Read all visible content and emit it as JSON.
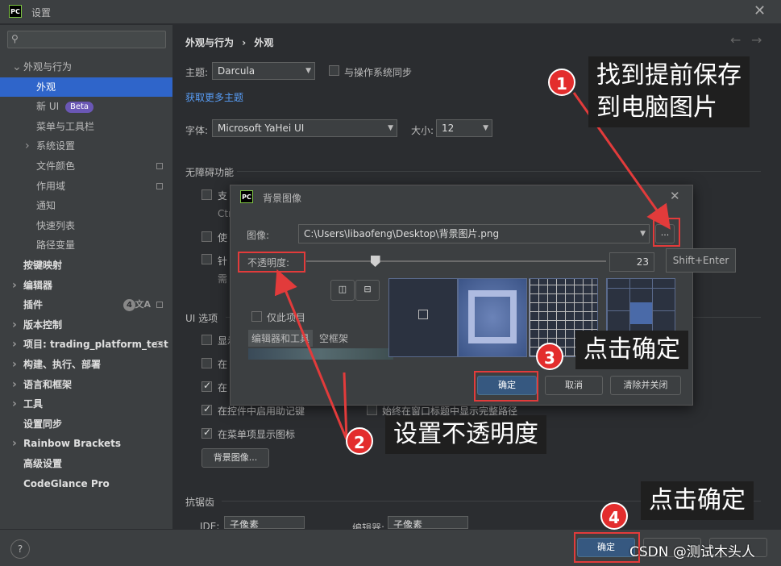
{
  "window": {
    "title": "设置",
    "logo": "PC"
  },
  "search": {
    "placeholder": ""
  },
  "sidebar": {
    "items": [
      {
        "label": "外观与行为",
        "level": 0,
        "expanded": true
      },
      {
        "label": "外观",
        "level": 1,
        "selected": true
      },
      {
        "label": "新 UI",
        "level": 1,
        "badge": "Beta"
      },
      {
        "label": "菜单与工具栏",
        "level": 1
      },
      {
        "label": "系统设置",
        "level": 1,
        "collapsed": true
      },
      {
        "label": "文件颜色",
        "level": 1,
        "icon": "project-scope-icon"
      },
      {
        "label": "作用域",
        "level": 1,
        "icon": "project-scope-icon"
      },
      {
        "label": "通知",
        "level": 1
      },
      {
        "label": "快速列表",
        "level": 1
      },
      {
        "label": "路径变量",
        "level": 1
      },
      {
        "label": "按键映射",
        "level": 0,
        "bold": true
      },
      {
        "label": "编辑器",
        "level": 0,
        "collapsed": true,
        "bold": true
      },
      {
        "label": "插件",
        "level": 0,
        "bold": true,
        "count": "4"
      },
      {
        "label": "版本控制",
        "level": 0,
        "collapsed": true,
        "bold": true
      },
      {
        "label": "项目: trading_platform_test",
        "level": 0,
        "collapsed": true,
        "bold": true
      },
      {
        "label": "构建、执行、部署",
        "level": 0,
        "collapsed": true,
        "bold": true
      },
      {
        "label": "语言和框架",
        "level": 0,
        "collapsed": true,
        "bold": true
      },
      {
        "label": "工具",
        "level": 0,
        "collapsed": true,
        "bold": true
      },
      {
        "label": "设置同步",
        "level": 0,
        "bold": true
      },
      {
        "label": "Rainbow Brackets",
        "level": 0,
        "collapsed": true,
        "bold": true
      },
      {
        "label": "高级设置",
        "level": 0,
        "bold": true
      },
      {
        "label": "CodeGlance Pro",
        "level": 0,
        "bold": true
      }
    ]
  },
  "main": {
    "breadcrumb": {
      "parent": "外观与行为",
      "sep": "›",
      "current": "外观"
    },
    "theme_label": "主题:",
    "theme_value": "Darcula",
    "sync_os_label": "与操作系统同步",
    "more_themes_link": "获取更多主题",
    "font_label": "字体:",
    "font_value": "Microsoft YaHei UI",
    "size_label": "大小:",
    "size_value": "12",
    "accessibility_title": "无障碍功能",
    "acc_item1": "支",
    "acc_item1_sub": "Ctr",
    "acc_item2": "使",
    "acc_item3": "针",
    "acc_item3_sub": "需",
    "ui_options_title": "UI 选项",
    "ui_item1": "显示",
    "ui_item2": "在",
    "ui_item3": "在",
    "ui_item4": "在",
    "ui_mnemonic": "在控件中启用助记键",
    "ui_fullpath": "始终在窗口标题中显示完整路径",
    "ui_menu_icons": "在菜单项显示图标",
    "bg_image_button": "背景图像...",
    "antialias_title": "抗锯齿",
    "ide_label": "IDE:",
    "ide_value": "子像素",
    "editor_label": "编辑器:",
    "editor_value": "子像素"
  },
  "dialog": {
    "title": "背景图像",
    "image_label": "图像:",
    "image_path": "C:\\Users\\libaofeng\\Desktop\\背景图片.png",
    "browse_label": "...",
    "shortcut_tooltip": "Shift+Enter",
    "opacity_label": "不透明度:",
    "opacity_value": 23,
    "opacity_text": "23",
    "project_only_label": "仅此项目",
    "editor_tool_label": "编辑器和工具",
    "empty_frame_label": "空框架",
    "ok_label": "确定",
    "cancel_label": "取消",
    "clear_close_label": "清除并关闭"
  },
  "bottom": {
    "help_label": "?",
    "ok_label": "确定"
  },
  "annotations": {
    "step1_num": "1",
    "step1_text_line1": "找到提前保存",
    "step1_text_line2": "到电脑图片",
    "step2_num": "2",
    "step2_text": "设置不透明度",
    "step3_num": "3",
    "step3_text": "点击确定",
    "step4_num": "4",
    "step4_text": "点击确定",
    "watermark": "CSDN @测试木头人"
  },
  "colors": {
    "accent": "#2f65ca",
    "annotation_red": "#e23b3b",
    "primary_button": "#365880"
  }
}
